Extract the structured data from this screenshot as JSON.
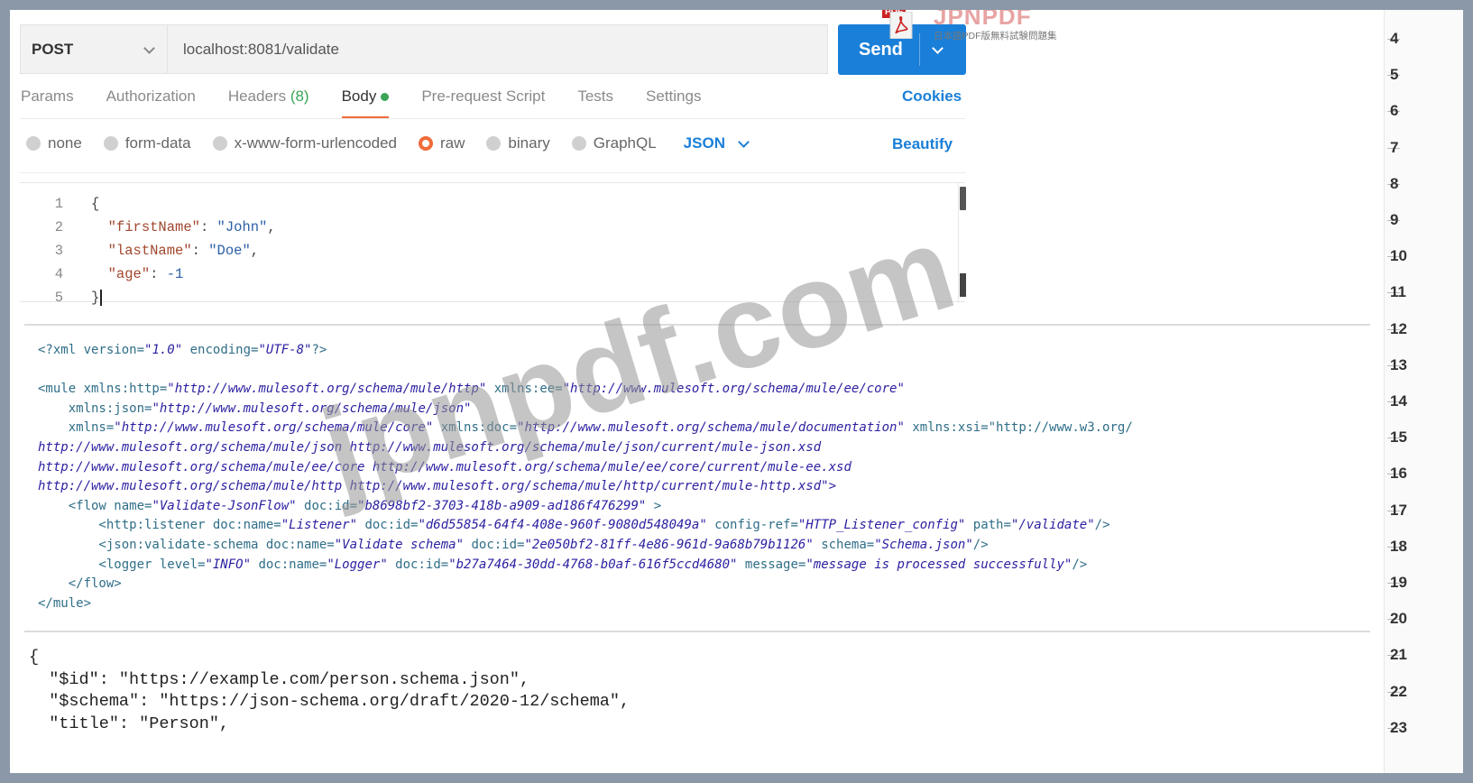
{
  "request": {
    "method": "POST",
    "url": "localhost:8081/validate",
    "send_label": "Send"
  },
  "tabs": [
    {
      "label": "Params"
    },
    {
      "label": "Authorization"
    },
    {
      "label": "Headers",
      "count": "(8)"
    },
    {
      "label": "Body"
    },
    {
      "label": "Pre-request Script"
    },
    {
      "label": "Tests"
    },
    {
      "label": "Settings"
    }
  ],
  "cookies_label": "Cookies",
  "body_types": [
    {
      "label": "none"
    },
    {
      "label": "form-data"
    },
    {
      "label": "x-www-form-urlencoded"
    },
    {
      "label": "raw"
    },
    {
      "label": "binary"
    },
    {
      "label": "GraphQL"
    }
  ],
  "format_label": "JSON",
  "beautify_label": "Beautify",
  "editor": {
    "line_numbers": [
      "1",
      "2",
      "3",
      "4",
      "5"
    ],
    "open_brace": "{",
    "close_brace": "}",
    "fields": [
      {
        "key": "\"firstName\"",
        "value": "\"John\"",
        "sep": ": ",
        "end": ","
      },
      {
        "key": "\"lastName\"",
        "value": "\"Doe\"",
        "sep": ": ",
        "end": ","
      },
      {
        "key": "\"age\"",
        "value": "-1",
        "sep": ": ",
        "end": ""
      }
    ]
  },
  "xml_lines": [
    "<?xml version=\"1.0\" encoding=\"UTF-8\"?>",
    "",
    "<mule xmlns:http=\"http://www.mulesoft.org/schema/mule/http\" xmlns:ee=\"http://www.mulesoft.org/schema/mule/ee/core\"",
    "    xmlns:json=\"http://www.mulesoft.org/schema/mule/json\"",
    "    xmlns=\"http://www.mulesoft.org/schema/mule/core\" xmlns:doc=\"http://www.mulesoft.org/schema/mule/documentation\" xmlns:xsi=\"http://www.w3.org/",
    "http://www.mulesoft.org/schema/mule/json http://www.mulesoft.org/schema/mule/json/current/mule-json.xsd",
    "http://www.mulesoft.org/schema/mule/ee/core http://www.mulesoft.org/schema/mule/ee/core/current/mule-ee.xsd",
    "http://www.mulesoft.org/schema/mule/http http://www.mulesoft.org/schema/mule/http/current/mule-http.xsd\">",
    "    <flow name=\"Validate-JsonFlow\" doc:id=\"b8698bf2-3703-418b-a909-ad186f476299\" >",
    "        <http:listener doc:name=\"Listener\" doc:id=\"d6d55854-64f4-408e-960f-9080d548049a\" config-ref=\"HTTP_Listener_config\" path=\"/validate\"/>",
    "        <json:validate-schema doc:name=\"Validate schema\" doc:id=\"2e050bf2-81ff-4e86-961d-9a68b79b1126\" schema=\"Schema.json\"/>",
    "        <logger level=\"INFO\" doc:name=\"Logger\" doc:id=\"b27a7464-30dd-4768-b0af-616f5ccd4680\" message=\"message is processed successfully\"/>",
    "    </flow>",
    "</mule>"
  ],
  "json_lines": [
    "{",
    "  \"$id\": \"https://example.com/person.schema.json\",",
    "  \"$schema\": \"https://json-schema.org/draft/2020-12/schema\",",
    "  \"title\": \"Person\","
  ],
  "right_numbers": [
    "4",
    "5",
    "6",
    "7",
    "8",
    "9",
    "10",
    "11",
    "12",
    "13",
    "14",
    "15",
    "16",
    "17",
    "18",
    "19",
    "20",
    "21",
    "22",
    "23"
  ],
  "watermark": {
    "logo_tag": "PDF",
    "logo_title": "JPNPDF",
    "logo_subtitle": "日本語PDF版無料試験問題集",
    "overlay_text": "jpnpdf.com"
  },
  "colors": {
    "accent_blue": "#1a7fd8",
    "active_orange": "#f26b3a",
    "status_green": "#3aa555"
  }
}
